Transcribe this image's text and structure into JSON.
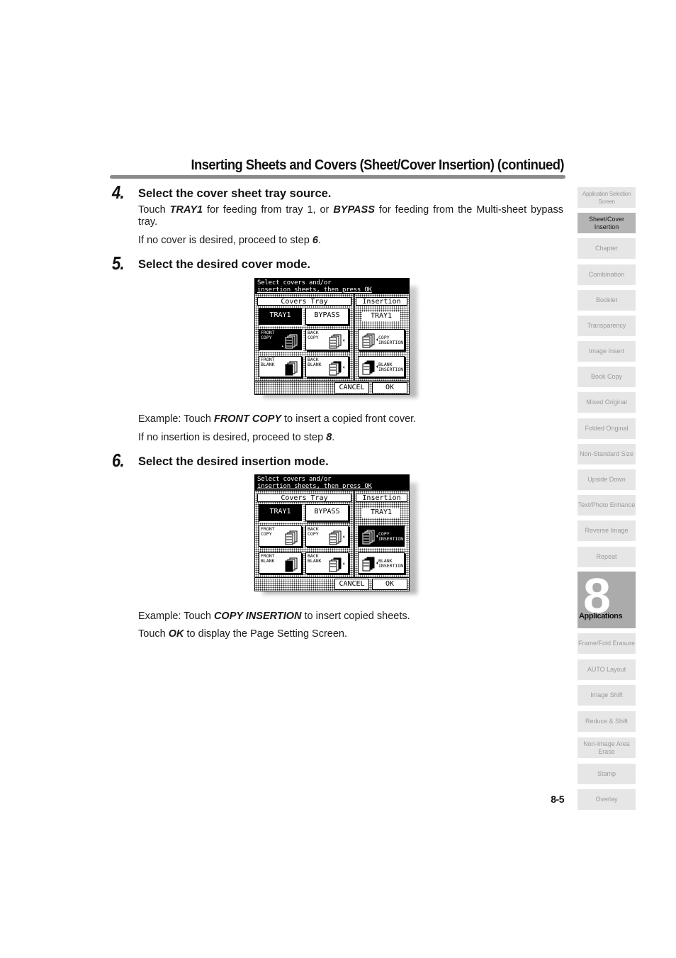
{
  "page": {
    "title": "Inserting Sheets and Covers (Sheet/Cover Insertion) (continued)",
    "page_number": "8-5"
  },
  "steps": [
    {
      "number": "4.",
      "heading": "Select the cover sheet tray source.",
      "para1": {
        "a": "Touch ",
        "b1": "TRAY1",
        "c": " for feeding from tray 1, or ",
        "b2": "BYPASS",
        "d": " for feeding from the Multi-sheet bypass tray."
      },
      "para2": {
        "a": "If no cover is desired, proceed to step ",
        "b": "6",
        "c": "."
      }
    },
    {
      "number": "5.",
      "heading": "Select the desired cover mode.",
      "para1": {
        "a": "Example: Touch ",
        "b": "FRONT COPY",
        "c": " to insert a copied front cover."
      },
      "para2": {
        "a": "If no insertion is desired, proceed to step ",
        "b": "8",
        "c": "."
      }
    },
    {
      "number": "6.",
      "heading": "Select the desired insertion mode.",
      "para1": {
        "a": "Example: Touch ",
        "b": "COPY INSERTION",
        "c": " to insert copied sheets."
      },
      "para2": {
        "a": "Touch ",
        "b": "OK",
        "c": " to display the Page Setting Screen."
      }
    }
  ],
  "screens": [
    {
      "message_line1": "Select covers and/or",
      "message_line2": "insertion sheets, then press OK",
      "covers_tray_label": "Covers Tray",
      "insertion_label": "Insertion",
      "tray1": "TRAY1",
      "bypass": "BYPASS",
      "insertion_tray": "TRAY1",
      "front_copy": [
        "FRONT",
        "COPY"
      ],
      "back_copy": [
        "BACK",
        "COPY"
      ],
      "front_blank": [
        "FRONT",
        "BLANK"
      ],
      "back_blank": [
        "BACK",
        "BLANK"
      ],
      "copy_insertion": [
        "COPY",
        "INSERTION"
      ],
      "blank_insertion": [
        "BLANK",
        "INSERTION"
      ],
      "cancel": "CANCEL",
      "ok": "OK",
      "selected": [
        "TRAY1",
        "FRONT COPY"
      ]
    },
    {
      "message_line1": "Select covers and/or",
      "message_line2": "insertion sheets, then press OK",
      "covers_tray_label": "Covers Tray",
      "insertion_label": "Insertion",
      "tray1": "TRAY1",
      "bypass": "BYPASS",
      "insertion_tray": "TRAY1",
      "front_copy": [
        "FRONT",
        "COPY"
      ],
      "back_copy": [
        "BACK",
        "COPY"
      ],
      "front_blank": [
        "FRONT",
        "BLANK"
      ],
      "back_blank": [
        "BACK",
        "BLANK"
      ],
      "copy_insertion": [
        "COPY",
        "INSERTION"
      ],
      "blank_insertion": [
        "BLANK",
        "INSERTION"
      ],
      "cancel": "CANCEL",
      "ok": "OK",
      "selected": [
        "TRAY1",
        "COPY INSERTION"
      ]
    }
  ],
  "side_index": {
    "tabs_top": [
      "Application Selection Screen",
      "Sheet/Cover Insertion",
      "Chapter",
      "Combination",
      "Booklet",
      "Transparency",
      "Image Insert",
      "Book Copy",
      "Mixed Original",
      "Folded Original",
      "Non-Standard Size",
      "Upside Down",
      "Text/Photo Enhance",
      "Reverse Image",
      "Repeat"
    ],
    "active_tab": "Sheet/Cover Insertion",
    "chapter_number": "8",
    "chapter_label": "Applications",
    "tabs_bottom": [
      "Frame/Fold Erasure",
      "AUTO Layout",
      "Image Shift",
      "Reduce & Shift",
      "Non-Image Area Erase",
      "Stamp",
      "Overlay"
    ]
  }
}
